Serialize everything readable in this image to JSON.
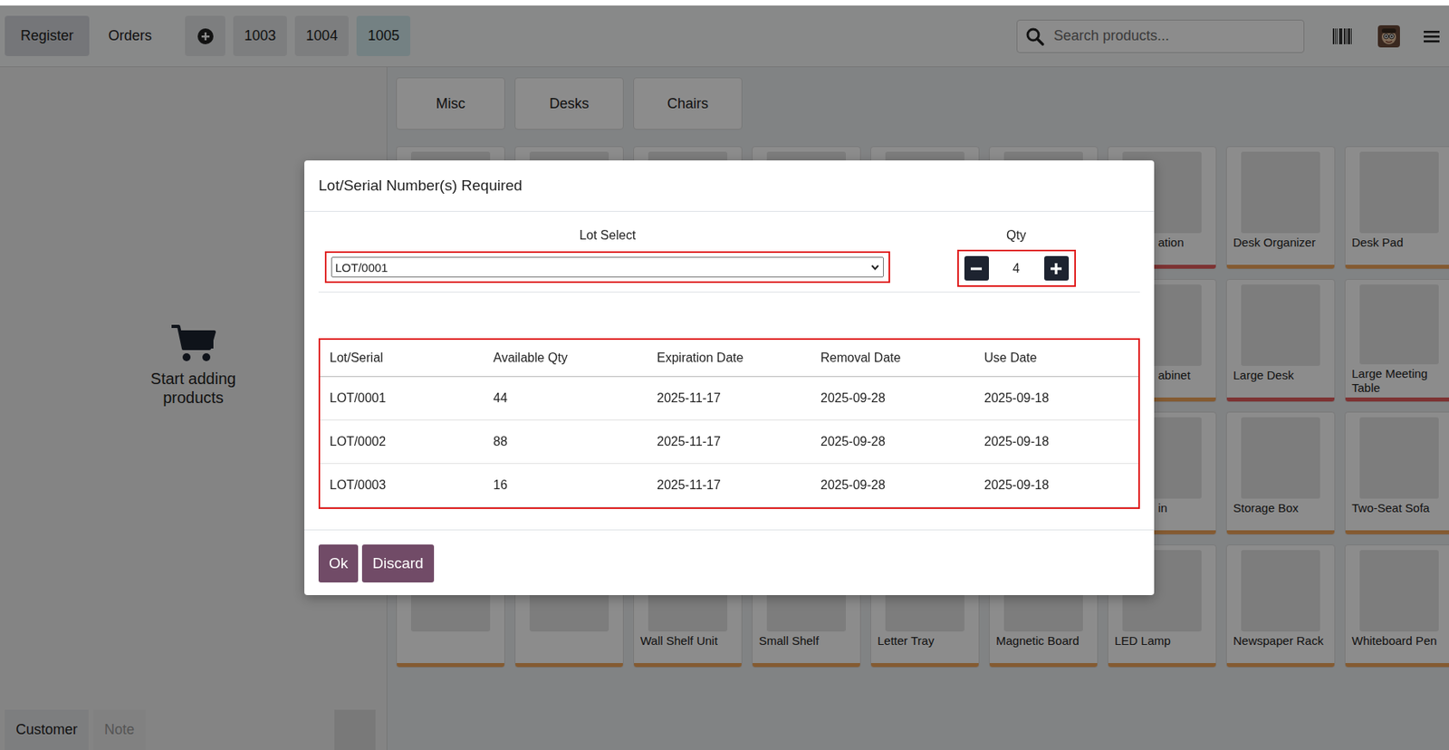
{
  "nav": [
    {
      "label": "Register",
      "selected": true
    },
    {
      "label": "Orders",
      "selected": false
    }
  ],
  "orders": [
    {
      "label": "1003",
      "selected": false
    },
    {
      "label": "1004",
      "selected": false
    },
    {
      "label": "1005",
      "selected": true
    }
  ],
  "search": {
    "placeholder": "Search products..."
  },
  "cart": {
    "empty_text": "Start adding products"
  },
  "footer_buttons": [
    {
      "label": "Customer",
      "disabled": false
    },
    {
      "label": "Note",
      "disabled": true
    }
  ],
  "categories": [
    "Misc",
    "Desks",
    "Chairs"
  ],
  "products": [
    {
      "kind": "blank",
      "color": "#f0a65c"
    },
    {
      "kind": "blank",
      "color": "#f0a65c"
    },
    {
      "kind": "blank",
      "color": "#f0a65c"
    },
    {
      "kind": "blank",
      "color": "#f0a65c"
    },
    {
      "kind": "blank",
      "color": "#f0a65c"
    },
    {
      "kind": "blank",
      "color": "#f0a65c"
    },
    {
      "kind": "partial",
      "name": "ation",
      "color": "#e35d5d"
    },
    {
      "kind": "full",
      "name": "Desk Organizer",
      "color": "#f0a65c"
    },
    {
      "kind": "full",
      "name": "Desk Pad",
      "color": "#f0a65c"
    },
    {
      "kind": "blank",
      "color": "#f0a65c"
    },
    {
      "kind": "blank",
      "color": "#f0a65c"
    },
    {
      "kind": "blank",
      "color": "#f0a65c"
    },
    {
      "kind": "blank",
      "color": "#f0a65c"
    },
    {
      "kind": "blank",
      "color": "#f0a65c"
    },
    {
      "kind": "blank",
      "color": "#f0a65c"
    },
    {
      "kind": "partial",
      "name": "abinet",
      "color": "#f0a65c"
    },
    {
      "kind": "full",
      "name": "Large Desk",
      "color": "#e35d5d"
    },
    {
      "kind": "full",
      "name": "Large Meeting Table",
      "color": "#e35d5d"
    },
    {
      "kind": "blank",
      "color": "#f0a65c"
    },
    {
      "kind": "blank",
      "color": "#f0a65c"
    },
    {
      "kind": "blank",
      "color": "#f0a65c"
    },
    {
      "kind": "blank",
      "color": "#f0a65c"
    },
    {
      "kind": "blank",
      "color": "#f0a65c"
    },
    {
      "kind": "blank",
      "color": "#f0a65c"
    },
    {
      "kind": "partial",
      "name": "in",
      "color": "#f0a65c"
    },
    {
      "kind": "full",
      "name": "Storage Box",
      "color": "#f0a65c"
    },
    {
      "kind": "full",
      "name": "Two-Seat Sofa",
      "color": "#f0a65c"
    },
    {
      "kind": "blank",
      "color": "#f0a65c"
    },
    {
      "kind": "blank",
      "color": "#f0a65c"
    },
    {
      "kind": "full",
      "name": "Wall Shelf Unit",
      "color": "#f0a65c"
    },
    {
      "kind": "full",
      "name": "Small Shelf",
      "color": "#f0a65c"
    },
    {
      "kind": "full",
      "name": "Letter Tray",
      "color": "#f0a65c"
    },
    {
      "kind": "full",
      "name": "Magnetic Board",
      "color": "#f0a65c"
    },
    {
      "kind": "full",
      "name": "LED Lamp",
      "color": "#f0a65c"
    },
    {
      "kind": "full",
      "name": "Newspaper Rack",
      "color": "#f0a65c"
    },
    {
      "kind": "full",
      "name": "Whiteboard Pen",
      "color": "#f0a65c"
    }
  ],
  "dialog": {
    "title": "Lot/Serial Number(s) Required",
    "lot_label": "Lot Select",
    "lot_value": "LOT/0001",
    "qty_label": "Qty",
    "qty_value": "4",
    "table": {
      "columns": [
        "Lot/Serial",
        "Available Qty",
        "Expiration Date",
        "Removal Date",
        "Use Date"
      ],
      "rows": [
        [
          "LOT/0001",
          "44",
          "2025-11-17",
          "2025-09-28",
          "2025-09-18"
        ],
        [
          "LOT/0002",
          "88",
          "2025-11-17",
          "2025-09-28",
          "2025-09-18"
        ],
        [
          "LOT/0003",
          "16",
          "2025-11-17",
          "2025-09-28",
          "2025-09-18"
        ]
      ]
    },
    "buttons": [
      "Ok",
      "Discard"
    ]
  }
}
